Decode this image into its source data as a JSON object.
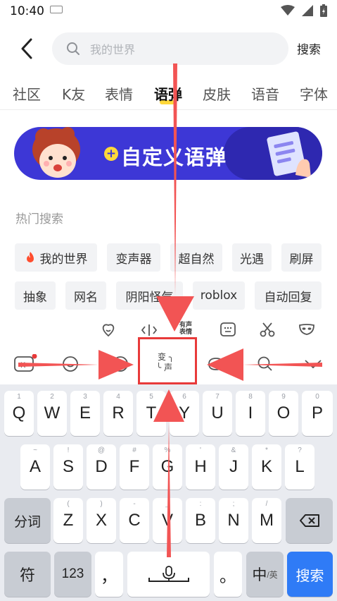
{
  "status_bar": {
    "time": "10:40"
  },
  "search": {
    "placeholder": "我的世界",
    "button_label": "搜索"
  },
  "tabs": [
    "社区",
    "K友",
    "表情",
    "语弹",
    "皮肤",
    "语音",
    "字体"
  ],
  "active_tab": "语弹",
  "banner": {
    "text": "自定义语弹"
  },
  "hot_search": {
    "title": "热门搜索",
    "row1": [
      "我的世界",
      "变声器",
      "超自然",
      "光遇",
      "刷屏"
    ],
    "row2": [
      "抽象",
      "网名",
      "阴阳怪气",
      "roblox",
      "自动回复"
    ]
  },
  "toolbar": {
    "voice_emoji_label_top": "有声",
    "voice_emoji_label_bottom": "表情",
    "voice_change_top": "变",
    "voice_change_bottom": "声"
  },
  "keyboard": {
    "row1": [
      [
        "Q",
        "1"
      ],
      [
        "W",
        "2"
      ],
      [
        "E",
        "3"
      ],
      [
        "R",
        "4"
      ],
      [
        "T",
        "5"
      ],
      [
        "Y",
        "6"
      ],
      [
        "U",
        "7"
      ],
      [
        "I",
        "8"
      ],
      [
        "O",
        "9"
      ],
      [
        "P",
        "0"
      ]
    ],
    "row2": [
      [
        "A",
        "~"
      ],
      [
        "S",
        "!"
      ],
      [
        "D",
        "@"
      ],
      [
        "F",
        "#"
      ],
      [
        "G",
        "%"
      ],
      [
        "H",
        "'"
      ],
      [
        "J",
        "&"
      ],
      [
        "K",
        "*"
      ],
      [
        "L",
        "?"
      ]
    ],
    "row3": [
      [
        "Z",
        "("
      ],
      [
        "X",
        ")"
      ],
      [
        "C",
        "-"
      ],
      [
        "V",
        "_"
      ],
      [
        "B",
        ":"
      ],
      [
        "N",
        ";"
      ],
      [
        "M",
        "/"
      ]
    ],
    "seg_label": "分词",
    "sym_label": "符",
    "num_label": "123",
    "comma_label": "，",
    "period_label": "。",
    "lang_main": "中",
    "lang_sub": "/英",
    "search_label": "搜索"
  },
  "colors": {
    "accent": "#2f7bf6",
    "banner": "#3d37d6",
    "annotation": "#e83a3a",
    "tab_underline": "#ffd83a"
  }
}
